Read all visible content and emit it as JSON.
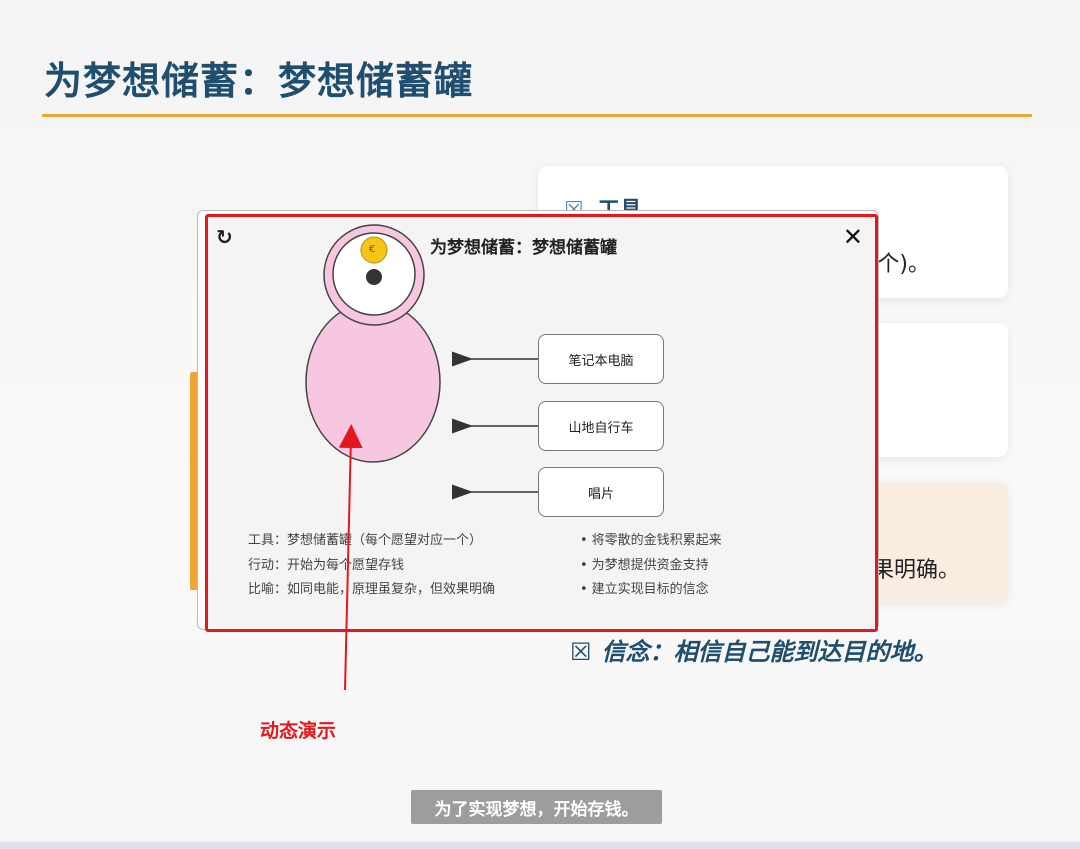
{
  "slide": {
    "title": "为梦想储蓄：梦想储蓄罐",
    "belief": "信念：相信自己能到达目的地。",
    "box_glyph": "☒"
  },
  "cards": {
    "card1_heading": "工具",
    "card1_tail": "个)。",
    "card3_tail": "果明确。"
  },
  "popup": {
    "title": "为梦想储蓄：梦想储蓄罐",
    "refresh_icon": "refresh-icon",
    "close_icon": "close-icon",
    "coin_symbol": "€",
    "targets": [
      "笔记本电脑",
      "山地自行车",
      "唱片"
    ],
    "info_left": [
      "工具：梦想储蓄罐（每个愿望对应一个）",
      "行动：开始为每个愿望存钱",
      "比喻：如同电能，原理虽复杂，但效果明确"
    ],
    "info_right": [
      "将零散的金钱积累起来",
      "为梦想提供资金支持",
      "建立实现目标的信念"
    ]
  },
  "annotation": {
    "demo_label": "动态演示"
  },
  "subtitle": "为了实现梦想，开始存钱。",
  "colors": {
    "title": "#1f4e6e",
    "accent": "#f0a534",
    "highlight_red": "#e3171c",
    "jar_pink": "#f7c6e0"
  }
}
